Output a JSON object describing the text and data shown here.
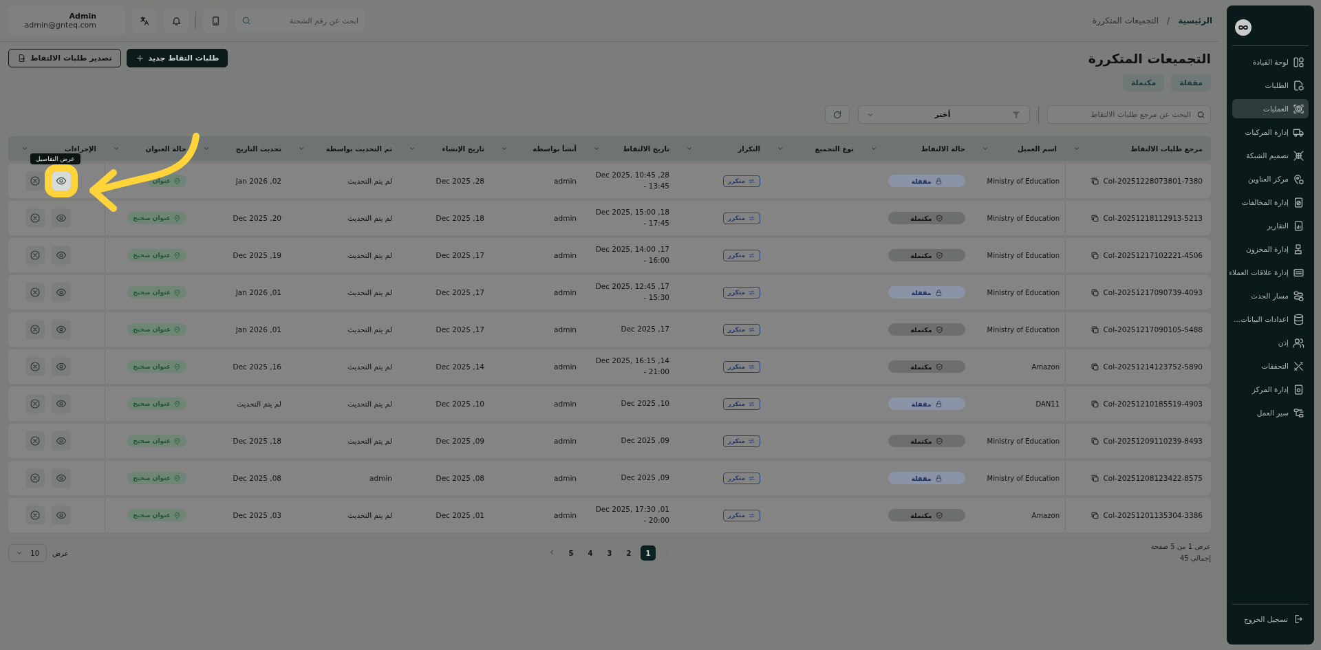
{
  "header": {
    "user": {
      "name": "Admin",
      "email": "admin@gnteq.com"
    },
    "search": {
      "placeholder": "ابحث عن رقم الشحنة"
    },
    "breadcrumb_separator": "/",
    "breadcrumb": [
      {
        "label": "الرئيسية",
        "selected": false
      },
      {
        "label": "التجميعات المتكررة",
        "selected": true
      }
    ]
  },
  "page": {
    "title": "التجميعات المتكررة",
    "buttons": [
      {
        "kind": "primary",
        "label": "طلبات التقاط جديد"
      },
      {
        "kind": "outline",
        "label": "تصدير طلبات الالتقاط"
      }
    ],
    "tabs": [
      {
        "label": "مقفلة",
        "selected": false
      },
      {
        "label": "مكتملة",
        "selected": false
      }
    ],
    "search": {
      "placeholder": "البحث عن مرجع طلبات الالتقاط"
    },
    "filter": {
      "value": "أختر"
    }
  },
  "sidebar": {
    "items": [
      {
        "label": "لوحة القيادة",
        "selected": false
      },
      {
        "label": "الطلبات",
        "selected": false
      },
      {
        "label": "العمليات",
        "selected": true
      },
      {
        "label": "إدارة المركبات",
        "selected": false
      },
      {
        "label": "تصميم الشبكة",
        "selected": false
      },
      {
        "label": "مركز العناوين",
        "selected": false
      },
      {
        "label": "إدارة المخالفات",
        "selected": false
      },
      {
        "label": "التقارير",
        "selected": false
      },
      {
        "label": "إدارة المخزون",
        "selected": false
      },
      {
        "label": "إدارة علاقات العملاء",
        "selected": false
      },
      {
        "label": "مسار الحدث",
        "selected": false
      },
      {
        "label": "اعدادات البيانات...",
        "selected": false
      },
      {
        "label": "إذن",
        "selected": false
      },
      {
        "label": "التحققات",
        "selected": false
      },
      {
        "label": "إدارة المركز",
        "selected": false
      },
      {
        "label": "سير العمل",
        "selected": false
      }
    ],
    "logout": "تسجيل الخروج"
  },
  "table": {
    "columns": [
      "مرجع طلبات الالتقاط",
      "اسم العميل",
      "حالة الالتقاط",
      "نوع التجميع",
      "التكرار",
      "تاريخ الالتقاط",
      "أنشأ بواسطة",
      "تاريخ الإنشاء",
      "تم التحديث بواسطة",
      "تحديث التاريخ",
      "حالة العنوان",
      "الإجراءات"
    ],
    "rows": [
      {
        "ref": "Col-20251228073801-7380",
        "client": "Ministry of Education",
        "status": {
          "kind": "locked",
          "label": "مقفلة"
        },
        "repeat": "متكرر",
        "pickup_date": "28, Dec 2025, 10:45 - 13:45",
        "created_by": "admin",
        "created_at": "28, Dec 2025",
        "updated_by": "لم يتم التحديث",
        "updated_at": "02, Jan 2026",
        "address": "عنوان",
        "highlighted": true
      },
      {
        "ref": "Col-20251218112913-5213",
        "client": "Ministry of Education",
        "status": {
          "kind": "complete",
          "label": "مكتملة"
        },
        "repeat": "متكرر",
        "pickup_date": "18, Dec 2025, 15:00 - 17:45",
        "created_by": "admin",
        "created_at": "18, Dec 2025",
        "updated_by": "لم يتم التحديث",
        "updated_at": "20, Dec 2025",
        "address": "عنوان صحيح",
        "highlighted": false
      },
      {
        "ref": "Col-20251217102221-4506",
        "client": "Ministry of Education",
        "status": {
          "kind": "complete",
          "label": "مكتملة"
        },
        "repeat": "متكرر",
        "pickup_date": "17, Dec 2025, 14:00 - 16:00",
        "created_by": "admin",
        "created_at": "17, Dec 2025",
        "updated_by": "لم يتم التحديث",
        "updated_at": "19, Dec 2025",
        "address": "عنوان صحيح",
        "highlighted": false
      },
      {
        "ref": "Col-20251217090739-4093",
        "client": "Ministry of Education",
        "status": {
          "kind": "locked",
          "label": "مقفلة"
        },
        "repeat": "متكرر",
        "pickup_date": "17, Dec 2025, 12:45 - 15:30",
        "created_by": "admin",
        "created_at": "17, Dec 2025",
        "updated_by": "لم يتم التحديث",
        "updated_at": "01, Jan 2026",
        "address": "عنوان صحيح",
        "highlighted": false
      },
      {
        "ref": "Col-20251217090105-5488",
        "client": "Ministry of Education",
        "status": {
          "kind": "complete",
          "label": "مكتملة"
        },
        "repeat": "متكرر",
        "pickup_date": "17, Dec 2025",
        "created_by": "admin",
        "created_at": "17, Dec 2025",
        "updated_by": "لم يتم التحديث",
        "updated_at": "01, Jan 2026",
        "address": "عنوان صحيح",
        "highlighted": false
      },
      {
        "ref": "Col-20251214123752-5890",
        "client": "Amazon",
        "status": {
          "kind": "complete",
          "label": "مكتملة"
        },
        "repeat": "متكرر",
        "pickup_date": "14, Dec 2025, 16:15 - 21:00",
        "created_by": "admin",
        "created_at": "14, Dec 2025",
        "updated_by": "لم يتم التحديث",
        "updated_at": "16, Dec 2025",
        "address": "عنوان صحيح",
        "highlighted": false
      },
      {
        "ref": "Col-20251210185519-4903",
        "client": "DAN11",
        "status": {
          "kind": "locked",
          "label": "مقفلة"
        },
        "repeat": "متكرر",
        "pickup_date": "10, Dec 2025",
        "created_by": "admin",
        "created_at": "10, Dec 2025",
        "updated_by": "لم يتم التحديث",
        "updated_at": "لم يتم التحديث",
        "address": "عنوان صحيح",
        "highlighted": false
      },
      {
        "ref": "Col-20251209110239-8493",
        "client": "Ministry of Education",
        "status": {
          "kind": "complete",
          "label": "مكتملة"
        },
        "repeat": "متكرر",
        "pickup_date": "09, Dec 2025",
        "created_by": "admin",
        "created_at": "09, Dec 2025",
        "updated_by": "لم يتم التحديث",
        "updated_at": "18, Dec 2025",
        "address": "عنوان صحيح",
        "highlighted": false
      },
      {
        "ref": "Col-20251208123422-8575",
        "client": "Ministry of Education",
        "status": {
          "kind": "locked",
          "label": "مقفلة"
        },
        "repeat": "متكرر",
        "pickup_date": "09, Dec 2025",
        "created_by": "admin",
        "created_at": "08, Dec 2025",
        "updated_by": "admin",
        "updated_at": "08, Dec 2025",
        "address": "عنوان صحيح",
        "highlighted": false
      },
      {
        "ref": "Col-20251201135304-3386",
        "client": "Amazon",
        "status": {
          "kind": "complete",
          "label": "مكتملة"
        },
        "repeat": "متكرر",
        "pickup_date": "01, Dec 2025, 17:30 - 20:00",
        "created_by": "admin",
        "created_at": "01, Dec 2025",
        "updated_by": "لم يتم التحديث",
        "updated_at": "03, Dec 2025",
        "address": "عنوان صحيح",
        "highlighted": false
      }
    ]
  },
  "tour": {
    "tooltip": "عرض التفاصيل"
  },
  "pagination": {
    "summary": "عرض 1 من 5 صفحة",
    "total": "إجمالي 45",
    "prev_disabled": true,
    "pages": [
      {
        "label": "1",
        "selected": true
      },
      {
        "label": "2",
        "selected": false
      },
      {
        "label": "3",
        "selected": false
      },
      {
        "label": "4",
        "selected": false
      },
      {
        "label": "5",
        "selected": false
      }
    ],
    "page_size_label": "عرض",
    "page_size": "10"
  }
}
